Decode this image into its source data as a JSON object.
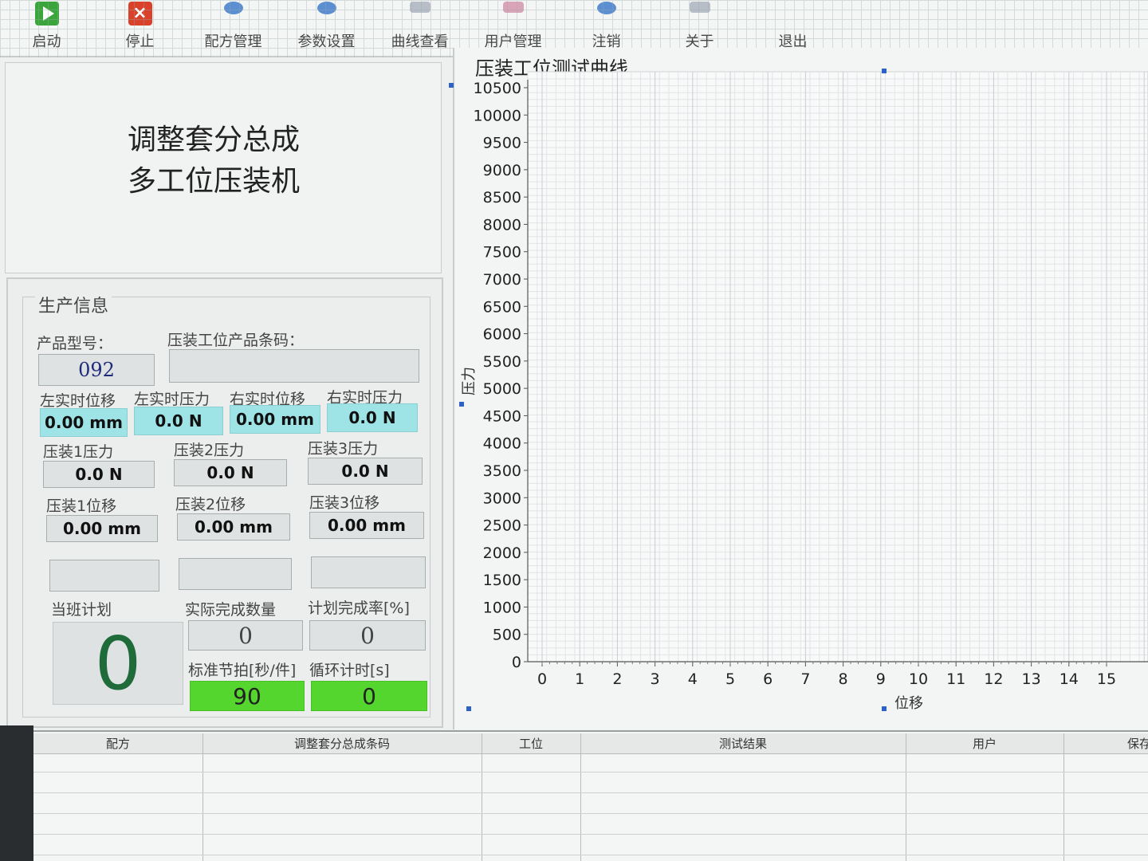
{
  "toolbar": {
    "items": [
      {
        "label": "启动",
        "icon": "start-icon"
      },
      {
        "label": "停止",
        "icon": "stop-icon"
      },
      {
        "label": "配方管理",
        "icon": "recipe-icon"
      },
      {
        "label": "参数设置",
        "icon": "settings-icon"
      },
      {
        "label": "曲线查看",
        "icon": "curve-icon"
      },
      {
        "label": "用户管理",
        "icon": "users-icon"
      },
      {
        "label": "注销",
        "icon": "logout-icon"
      },
      {
        "label": "关于",
        "icon": "about-icon"
      },
      {
        "label": "退出",
        "icon": "exit-icon"
      }
    ]
  },
  "machine": {
    "line1": "调整套分总成",
    "line2": "多工位压装机"
  },
  "production": {
    "group_title": "生产信息",
    "product_model_label": "产品型号：",
    "product_model_value": "092",
    "barcode_label": "压装工位产品条码：",
    "barcode_value": "",
    "realtime": [
      {
        "label": "左实时位移",
        "value": "0.00 mm"
      },
      {
        "label": "左实时压力",
        "value": "0.0 N"
      },
      {
        "label": "右实时位移",
        "value": "0.00 mm"
      },
      {
        "label": "右实时压力",
        "value": "0.0 N"
      }
    ],
    "press_force": [
      {
        "label": "压装1压力",
        "value": "0.0 N"
      },
      {
        "label": "压装2压力",
        "value": "0.0 N"
      },
      {
        "label": "压装3压力",
        "value": "0.0 N"
      }
    ],
    "press_disp": [
      {
        "label": "压装1位移",
        "value": "0.00 mm"
      },
      {
        "label": "压装2位移",
        "value": "0.00 mm"
      },
      {
        "label": "压装3位移",
        "value": "0.00 mm"
      }
    ],
    "shift_plan_label": "当班计划",
    "shift_plan_value": "0",
    "actual_label": "实际完成数量",
    "actual_value": "0",
    "rate_label": "计划完成率[%]",
    "rate_value": "0",
    "takt_label": "标准节拍[秒/件]",
    "takt_value": "90",
    "cycle_label": "循环计时[s]",
    "cycle_value": "0"
  },
  "chart_data": {
    "type": "line",
    "title": "压装工位测试曲线",
    "xlabel": "位移",
    "ylabel": "压力",
    "xlim": [
      0,
      15
    ],
    "ylim": [
      0,
      10500
    ],
    "x_ticks": [
      "0",
      "1",
      "2",
      "3",
      "4",
      "5",
      "6",
      "7",
      "8",
      "9",
      "10",
      "11",
      "12",
      "13",
      "14",
      "15"
    ],
    "y_ticks": [
      "0",
      "500",
      "1000",
      "1500",
      "2000",
      "2500",
      "3000",
      "3500",
      "4000",
      "4500",
      "5000",
      "5500",
      "6000",
      "6500",
      "7000",
      "7500",
      "8000",
      "8500",
      "9000",
      "9500",
      "10000",
      "10500"
    ],
    "grid": true,
    "series": []
  },
  "table": {
    "columns": [
      "配方",
      "调整套分总成条码",
      "工位",
      "测试结果",
      "用户",
      "保存"
    ],
    "rows": []
  },
  "colors": {
    "cyan_field": "#9ee3e6",
    "green_field": "#54d62f",
    "plan_digit": "#1f6b3a"
  }
}
